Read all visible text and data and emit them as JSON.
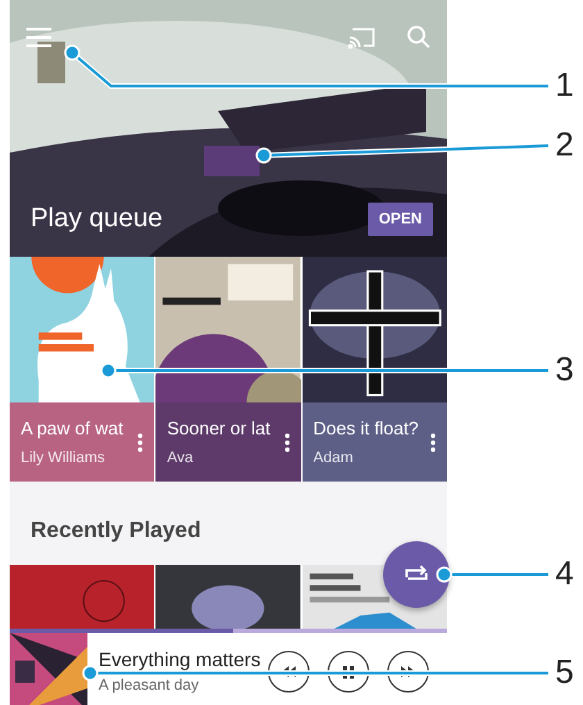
{
  "header": {
    "title": "Play queue",
    "button": "OPEN"
  },
  "play_queue": [
    {
      "title": "A paw of wat",
      "artist": "Lily Williams",
      "color": "#b86382"
    },
    {
      "title": "Sooner or lat",
      "artist": "Ava",
      "color": "#5e3a6a"
    },
    {
      "title": "Does it float?",
      "artist": "Adam",
      "color": "#5d5f87"
    }
  ],
  "recently_played": {
    "title": "Recently Played"
  },
  "now_playing": {
    "title": "Everything matters",
    "subtitle": "A pleasant day",
    "level": 0.51
  },
  "callouts": [
    "1",
    "2",
    "3",
    "4",
    "5"
  ]
}
